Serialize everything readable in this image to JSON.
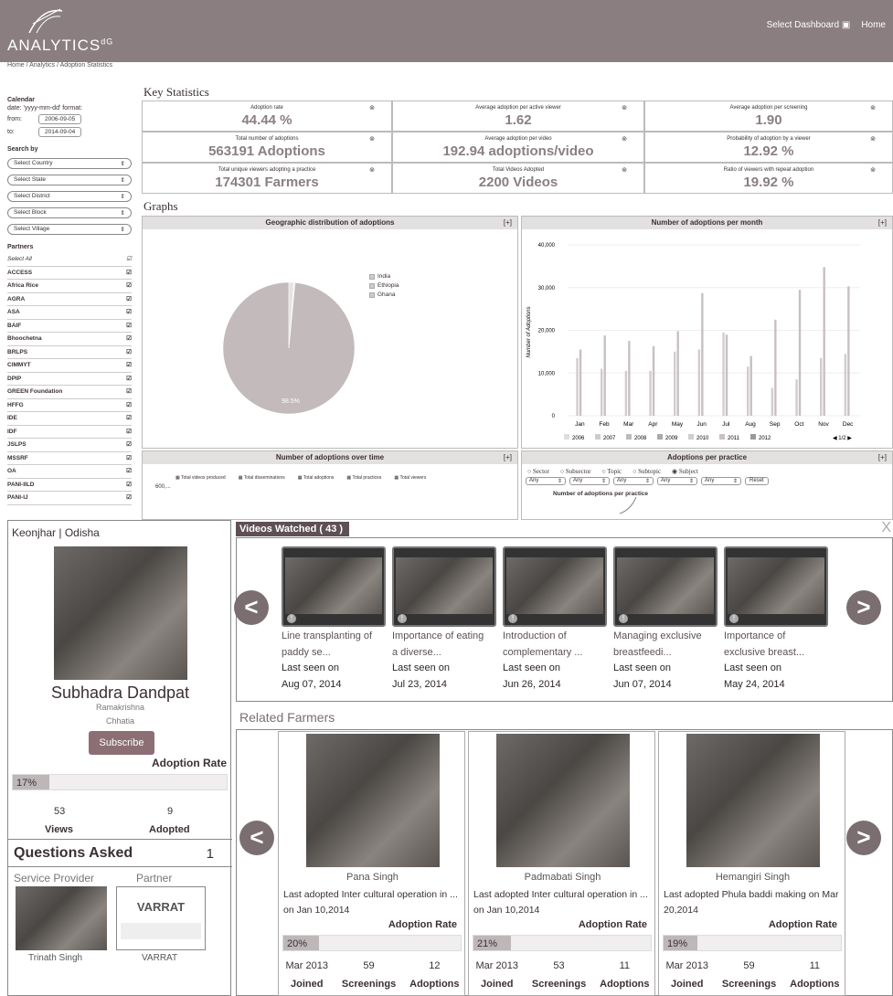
{
  "header": {
    "logo": "ANALYTICS",
    "logo_sup": "dG",
    "select_dashboard": "Select Dashboard",
    "home": "Home"
  },
  "breadcrumb": "Home / Analytics / Adoption Statistics",
  "sidebar": {
    "calendar_label": "Calendar",
    "date_format": "date: 'yyyy-mm-dd' format:",
    "from_label": "from:",
    "from_value": "2006-09-05",
    "to_label": "to:",
    "to_value": "2014-09-04",
    "search_by": "Search by",
    "selects": [
      "Select Country",
      "Select State",
      "Select District",
      "Select Block",
      "Select Village"
    ],
    "partners_label": "Partners",
    "partners": [
      "Select All",
      "ACCESS",
      "Africa Rice",
      "AGRA",
      "ASA",
      "BAIF",
      "Bhoochetna",
      "BRLPS",
      "CIMMYT",
      "DPIP",
      "GREEN Foundation",
      "HFFG",
      "IDE",
      "IDF",
      "JSLPS",
      "MSSRF",
      "OA",
      "PANI-IILD",
      "PANI-IJ"
    ]
  },
  "key_stats": {
    "title": "Key Statistics",
    "cells": [
      {
        "label": "Adoption rate",
        "value": "44.44 %"
      },
      {
        "label": "Average adoption per active viewer",
        "value": "1.62"
      },
      {
        "label": "Average adoption per screening",
        "value": "1.90"
      },
      {
        "label": "Total number of adoptions",
        "value": "563191 Adoptions"
      },
      {
        "label": "Average adoption per video",
        "value": "192.94 adoptions/video"
      },
      {
        "label": "Probability of adoption by a viewer",
        "value": "12.92 %"
      },
      {
        "label": "Total unique viewers adopting a practice",
        "value": "174301 Farmers"
      },
      {
        "label": "Total Videos Adopted",
        "value": "2200 Videos"
      },
      {
        "label": "Ratio of viewers with repeat adoption",
        "value": "19.92 %"
      }
    ]
  },
  "graphs": {
    "title": "Graphs",
    "expand": "[+]",
    "geo_title": "Geographic distribution of adoptions",
    "monthly_title": "Number of adoptions per month",
    "overtime_title": "Number of adoptions over time",
    "practice_title": "Adoptions per practice",
    "overtime_legend": [
      "Total videos produced",
      "Total disseminations",
      "Total adoptions",
      "Total practices",
      "Total viewers"
    ],
    "overtime_y": "600,...",
    "practice_radios": [
      "Sector",
      "Subsector",
      "Topic",
      "Subtopic",
      "Subject"
    ],
    "practice_any": "Any",
    "practice_reset": "Reset",
    "practice_sub": "Number of adoptions per practice",
    "month_pager": "1/2"
  },
  "chart_data": [
    {
      "type": "pie",
      "categories": [
        "India",
        "Ethiopia",
        "Ghana"
      ],
      "values": [
        98.5,
        1.2,
        0.3
      ],
      "slice_label": "98.5%",
      "legend": "right"
    },
    {
      "type": "bar",
      "categories": [
        "Jan",
        "Feb",
        "Mar",
        "Apr",
        "May",
        "Jun",
        "Jul",
        "Aug",
        "Sep",
        "Oct",
        "Nov",
        "Dec"
      ],
      "ylabel": "Number of Adoptions",
      "ylim": [
        0,
        40000
      ],
      "yticks": [
        "0",
        "10,000",
        "20,000",
        "30,000",
        "40,000"
      ],
      "series": [
        {
          "name": "2006",
          "values": [
            0,
            0,
            0,
            0,
            0,
            0,
            0,
            0,
            0,
            0,
            0,
            0
          ]
        },
        {
          "name": "2007",
          "values": [
            0,
            0,
            0,
            0,
            0,
            0,
            0,
            0,
            0,
            0,
            0,
            0
          ]
        },
        {
          "name": "2008",
          "values": [
            0,
            0,
            0,
            0,
            0,
            0,
            0,
            0,
            0,
            0,
            0,
            0
          ]
        },
        {
          "name": "2009",
          "values": [
            0,
            0,
            0,
            0,
            0,
            0,
            0,
            0,
            0,
            0,
            0,
            0
          ]
        },
        {
          "name": "2010",
          "values": [
            13500,
            11000,
            10500,
            10500,
            15000,
            15500,
            19500,
            11500,
            6500,
            8500,
            13500,
            14500
          ]
        },
        {
          "name": "2011",
          "values": [
            15500,
            18800,
            17500,
            16300,
            19800,
            28700,
            19000,
            14000,
            22500,
            29500,
            34800,
            30300
          ]
        },
        {
          "name": "2012",
          "values": [
            0,
            0,
            0,
            0,
            0,
            0,
            0,
            0,
            0,
            0,
            0,
            0
          ]
        }
      ],
      "legend": "bottom"
    }
  ],
  "profile": {
    "location": "Keonjhar | Odisha",
    "name": "Subhadra Dandpat",
    "sub1": "Ramakrishna",
    "sub2": "Chhatia",
    "subscribe": "Subscribe",
    "adoption_rate_label": "Adoption Rate",
    "adoption_rate": "17%",
    "adoption_rate_value": 17,
    "views_value": "53",
    "views_label": "Views",
    "adopted_value": "9",
    "adopted_label": "Adopted",
    "questions_label": "Questions Asked",
    "questions_count": "1",
    "service_provider_label": "Service Provider",
    "partner_label": "Partner",
    "service_provider_name": "Trinath Singh",
    "partner_logo": "VARRAT",
    "partner_name": "VARRAT"
  },
  "videos": {
    "header": "Videos Watched ( 43 )",
    "close": "X",
    "items": [
      {
        "title1": "Line transplanting of",
        "title2": "paddy se...",
        "seen": "Last seen on",
        "date": "Aug 07, 2014"
      },
      {
        "title1": "Importance of eating",
        "title2": "a diverse...",
        "seen": "Last seen on",
        "date": "Jul 23, 2014"
      },
      {
        "title1": "Introduction of",
        "title2": "complementary ...",
        "seen": "Last seen on",
        "date": "Jun 26, 2014"
      },
      {
        "title1": "Managing exclusive",
        "title2": "breastfeedi...",
        "seen": "Last seen on",
        "date": "Jun 07, 2014"
      },
      {
        "title1": "Importance of",
        "title2": "exclusive breast...",
        "seen": "Last seen on",
        "date": "May 24, 2014"
      }
    ]
  },
  "related": {
    "title": "Related Farmers",
    "farmers": [
      {
        "name": "Pana Singh",
        "last": "Last adopted Inter cultural operation in ... on Jan 10,2014",
        "ar_label": "Adoption Rate",
        "rate": "20%",
        "rate_value": 20,
        "joined": "Mar 2013",
        "joined_label": "Joined",
        "screenings": "59",
        "screenings_label": "Screenings",
        "adoptions": "12",
        "adoptions_label": "Adoptions"
      },
      {
        "name": "Padmabati Singh",
        "last": "Last adopted Inter cultural operation in ... on Jan 10,2014",
        "ar_label": "Adoption Rate",
        "rate": "21%",
        "rate_value": 21,
        "joined": "Mar 2013",
        "joined_label": "Joined",
        "screenings": "53",
        "screenings_label": "Screenings",
        "adoptions": "11",
        "adoptions_label": "Adoptions"
      },
      {
        "name": "Hemangiri Singh",
        "last": "Last adopted Phula baddi making on Mar 20,2014",
        "ar_label": "Adoption Rate",
        "rate": "19%",
        "rate_value": 19,
        "joined": "Mar 2013",
        "joined_label": "Joined",
        "screenings": "59",
        "screenings_label": "Screenings",
        "adoptions": "11",
        "adoptions_label": "Adoptions"
      }
    ]
  }
}
